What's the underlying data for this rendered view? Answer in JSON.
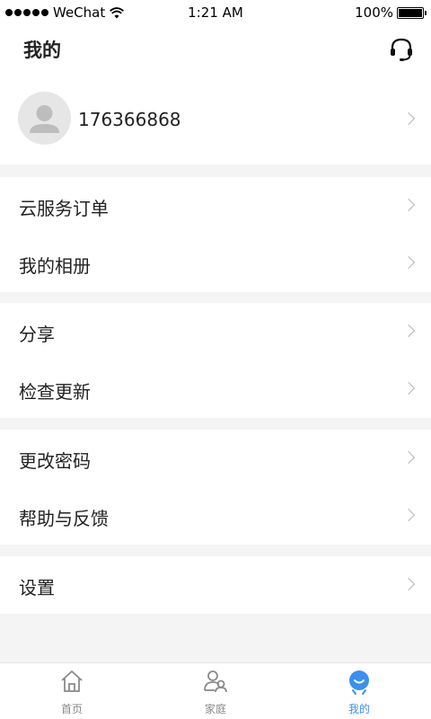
{
  "status_bar": {
    "carrier": "WeChat",
    "time": "1:21 AM",
    "battery": "100%"
  },
  "header": {
    "title": "我的",
    "support_icon": "headset-icon"
  },
  "profile": {
    "phone": "176366868",
    "avatar_icon": "user-avatar-icon"
  },
  "menu_groups": [
    [
      "云服务订单",
      "我的相册"
    ],
    [
      "分享",
      "检查更新"
    ],
    [
      "更改密码",
      "帮助与反馈"
    ],
    [
      "设置"
    ]
  ],
  "tabbar": {
    "tabs": [
      {
        "label": "首页",
        "icon": "home-icon",
        "active": false
      },
      {
        "label": "家庭",
        "icon": "family-icon",
        "active": false
      },
      {
        "label": "我的",
        "icon": "me-icon",
        "active": true
      }
    ],
    "accent_color": "#3a8ff0"
  }
}
